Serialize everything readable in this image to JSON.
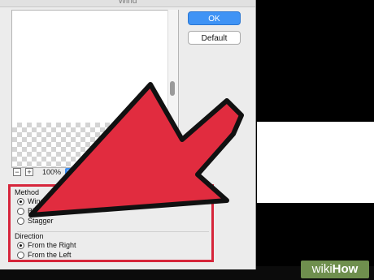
{
  "dialog": {
    "title": "Wind",
    "ok_label": "OK",
    "default_label": "Default",
    "zoom": {
      "minus": "−",
      "plus": "+",
      "value": "100%"
    },
    "method": {
      "title": "Method",
      "options": [
        "Wind",
        "Blast",
        "Stagger"
      ],
      "selected": "Wind"
    },
    "direction": {
      "title": "Direction",
      "options": [
        "From the Right",
        "From the Left"
      ],
      "selected": "From the Right"
    }
  },
  "watermark": {
    "part1": "wiki",
    "part2": "How"
  },
  "colors": {
    "accent": "#3f93f5",
    "highlight": "#d6263b",
    "arrow_fill": "#e12c3f"
  }
}
